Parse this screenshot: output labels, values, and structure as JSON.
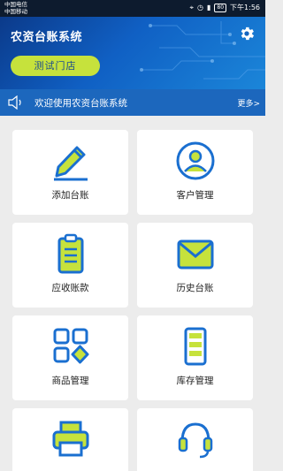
{
  "status_bar": {
    "carrier1": "中国电信",
    "carrier2": "中国移动",
    "battery": "80",
    "time": "下午1:56"
  },
  "header": {
    "title": "农资台账系统",
    "store_label": "测试门店",
    "icons": [
      "gear-icon"
    ]
  },
  "announcement": {
    "text": "欢迎使用农资台账系统",
    "more_label": "更多>",
    "icon": "speaker-icon"
  },
  "menu": {
    "items": [
      {
        "label": "添加台账",
        "icon": "pencil-icon"
      },
      {
        "label": "客户管理",
        "icon": "user-icon"
      },
      {
        "label": "应收账款",
        "icon": "clipboard-icon"
      },
      {
        "label": "历史台账",
        "icon": "envelope-icon"
      },
      {
        "label": "商品管理",
        "icon": "grid-icon"
      },
      {
        "label": "库存管理",
        "icon": "inventory-icon"
      },
      {
        "label": "",
        "icon": "printer-icon"
      },
      {
        "label": "",
        "icon": "headset-icon"
      }
    ]
  },
  "colors": {
    "primary_blue": "#1a6bcf",
    "accent_lime": "#c6e23c",
    "icon_stroke": "#1a6fd0"
  }
}
